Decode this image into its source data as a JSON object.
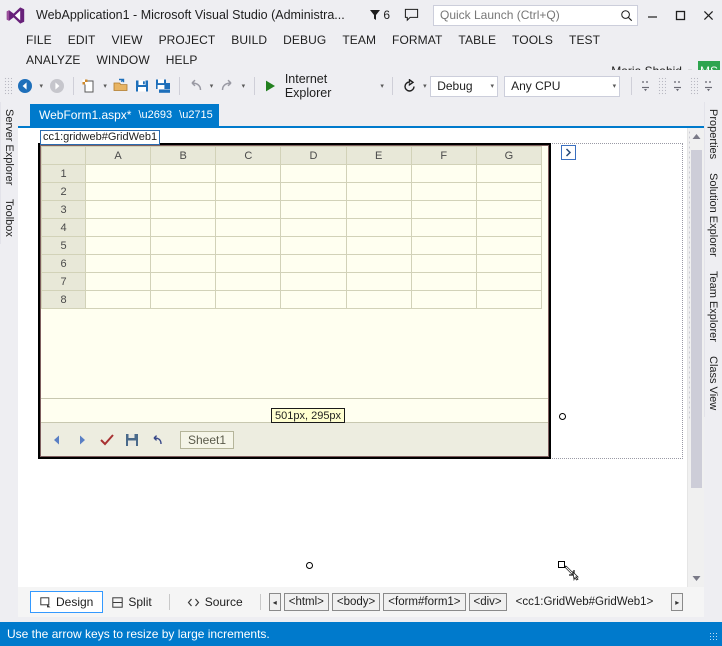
{
  "titlebar": {
    "app_title": "WebApplication1 - Microsoft Visual Studio (Administra...",
    "notification_count": "6",
    "flag_icon": "flag-icon",
    "feedback_icon": "feedback-icon",
    "quick_launch_placeholder": "Quick Launch (Ctrl+Q)",
    "quick_launch_value": "",
    "search_icon": "search-icon",
    "minimize_label": "–",
    "maximize_label": "❑",
    "close_label": "✕"
  },
  "menubar": {
    "row1": [
      {
        "label": "FILE",
        "accel": "F"
      },
      {
        "label": "EDIT",
        "accel": "E"
      },
      {
        "label": "VIEW",
        "accel": "V"
      },
      {
        "label": "PROJECT",
        "accel": "P"
      },
      {
        "label": "BUILD",
        "accel": "B"
      },
      {
        "label": "DEBUG",
        "accel": "D"
      },
      {
        "label": "TEAM",
        "accel": "M"
      },
      {
        "label": "FORMAT",
        "accel": "O"
      },
      {
        "label": "TABLE",
        "accel": "A"
      },
      {
        "label": "TOOLS",
        "accel": "T"
      },
      {
        "label": "TEST",
        "accel": ""
      }
    ],
    "row2": [
      {
        "label": "ANALYZE",
        "accel": "N"
      },
      {
        "label": "WINDOW",
        "accel": "W"
      },
      {
        "label": "HELP",
        "accel": "H"
      }
    ],
    "user_name": "Maria Shahid",
    "user_initials": "MS",
    "user_caret": "▾"
  },
  "toolbar": {
    "back_icon": "navigate-back-icon",
    "forward_icon": "navigate-forward-icon",
    "new_item_icon": "new-item-icon",
    "open_icon": "open-file-icon",
    "save_icon": "save-icon",
    "save_all_icon": "save-all-icon",
    "undo_icon": "undo-icon",
    "redo_icon": "redo-icon",
    "run_icon": "start-debug-icon",
    "run_label": "Internet Explorer",
    "refresh_icon": "refresh-icon",
    "configuration": "Debug",
    "platform": "Any CPU",
    "caret": "▾",
    "extra_icons": [
      "align-icon-1",
      "align-icon-2",
      "align-icon-3"
    ]
  },
  "dock_left": {
    "tabs": [
      "Server Explorer",
      "Toolbox"
    ]
  },
  "dock_right": {
    "tabs": [
      "Properties",
      "Solution Explorer",
      "Team Explorer",
      "Class View"
    ]
  },
  "document": {
    "tab_title": "WebForm1.aspx*",
    "pin_icon": "pin-icon",
    "close_icon": "close-icon",
    "control_tag": "cc1:gridweb#GridWeb1",
    "smart_tag_icon": "smart-tag-chevron-icon",
    "size_tooltip": "501px, 295px"
  },
  "gridweb": {
    "columns": [
      "A",
      "B",
      "C",
      "D",
      "E",
      "F",
      "G"
    ],
    "rows": [
      "1",
      "2",
      "3",
      "4",
      "5",
      "6",
      "7",
      "8"
    ],
    "cells": [
      [
        "",
        "",
        "",
        "",
        "",
        "",
        ""
      ],
      [
        "",
        "",
        "",
        "",
        "",
        "",
        ""
      ],
      [
        "",
        "",
        "",
        "",
        "",
        "",
        ""
      ],
      [
        "",
        "",
        "",
        "",
        "",
        "",
        ""
      ],
      [
        "",
        "",
        "",
        "",
        "",
        "",
        ""
      ],
      [
        "",
        "",
        "",
        "",
        "",
        "",
        ""
      ],
      [
        "",
        "",
        "",
        "",
        "",
        "",
        ""
      ],
      [
        "",
        "",
        "",
        "",
        "",
        "",
        ""
      ]
    ],
    "toolbar": {
      "prev_icon": "previous-sheet-icon",
      "next_icon": "next-sheet-icon",
      "submit_icon": "submit-check-icon",
      "save_icon": "save-icon",
      "undo_icon": "undo-icon",
      "sheet_name": "Sheet1"
    },
    "colors": {
      "header_bg": "#E8E8D8",
      "cell_bg": "#FFFFF0",
      "grid_line": "#D2D2B8",
      "border": "#7F5F5F"
    }
  },
  "viewbar": {
    "design_label": "Design",
    "design_icon": "design-view-icon",
    "split_label": "Split",
    "split_icon": "split-view-icon",
    "source_label": "Source",
    "source_icon": "source-view-icon",
    "breadcrumb_prev_icon": "◂",
    "breadcrumb_next_icon": "▸",
    "breadcrumb": [
      "<html>",
      "<body>",
      "<form#form1>",
      "<div>",
      "<cc1:GridWeb#GridWeb1>"
    ]
  },
  "statusbar": {
    "message": "Use the arrow keys to resize by large increments."
  },
  "colors": {
    "accent": "#007ACC",
    "chrome": "#EEEEF2",
    "avatar_green": "#2EA44F"
  }
}
